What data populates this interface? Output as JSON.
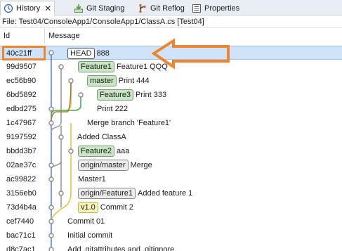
{
  "tabs": [
    {
      "label": "History",
      "icon": "history-icon",
      "active": true,
      "close": "✕"
    },
    {
      "label": "Git Staging",
      "icon": "git-staging-icon",
      "active": false
    },
    {
      "label": "Git Reflog",
      "icon": "git-reflog-icon",
      "active": false
    },
    {
      "label": "Properties",
      "icon": "properties-icon",
      "active": false
    }
  ],
  "path": "File: Test04/ConsoleApp1/ConsoleApp1/ClassA.cs [Test04]",
  "columns": {
    "id": "Id",
    "message": "Message"
  },
  "rows": [
    {
      "id": "40c21ff",
      "refs": [
        {
          "label": "HEAD",
          "kind": "head"
        }
      ],
      "message": "888",
      "selected": true
    },
    {
      "id": "99d9507",
      "refs": [
        {
          "label": "Feature1",
          "kind": "branch"
        }
      ],
      "message": "Feature1 QQQ"
    },
    {
      "id": "ec56b90",
      "refs": [
        {
          "label": "master",
          "kind": "branch"
        }
      ],
      "message": "Print 444"
    },
    {
      "id": "6bd5892",
      "refs": [
        {
          "label": "Feature3",
          "kind": "branch"
        }
      ],
      "message": "Print 333"
    },
    {
      "id": "edbd275",
      "refs": [],
      "message": "Print 222"
    },
    {
      "id": "1c47967",
      "refs": [],
      "message": "Merge branch 'Feature1'"
    },
    {
      "id": "9197592",
      "refs": [],
      "message": "Added ClassA"
    },
    {
      "id": "bbdd3b7",
      "refs": [
        {
          "label": "Feature2",
          "kind": "branch"
        }
      ],
      "message": "aaa"
    },
    {
      "id": "02ae37c",
      "refs": [
        {
          "label": "origin/master",
          "kind": "remote"
        }
      ],
      "message": "Merge"
    },
    {
      "id": "ac99822",
      "refs": [],
      "message": "Master1"
    },
    {
      "id": "3156eb0",
      "refs": [
        {
          "label": "origin/Feature1",
          "kind": "remote"
        }
      ],
      "message": "Added feature 1"
    },
    {
      "id": "73d4b4a",
      "refs": [
        {
          "label": "v1.0",
          "kind": "tag"
        }
      ],
      "message": "Commit 2"
    },
    {
      "id": "cef7440",
      "refs": [],
      "message": "Commit 01"
    },
    {
      "id": "bac71c1",
      "refs": [],
      "message": "Initial commit"
    },
    {
      "id": "d8c7ac1",
      "refs": [],
      "message": "Add .gitattributes and .gitignore."
    }
  ],
  "colors": {
    "lane_blue": "#5b7fd6",
    "lane_gray": "#9a9a9a",
    "lane_yellow": "#e0c640",
    "lane_green": "#4fa84f",
    "lane_brown": "#a07a30",
    "annotation_orange": "#f0852e",
    "selection": "#cfe4fa"
  }
}
